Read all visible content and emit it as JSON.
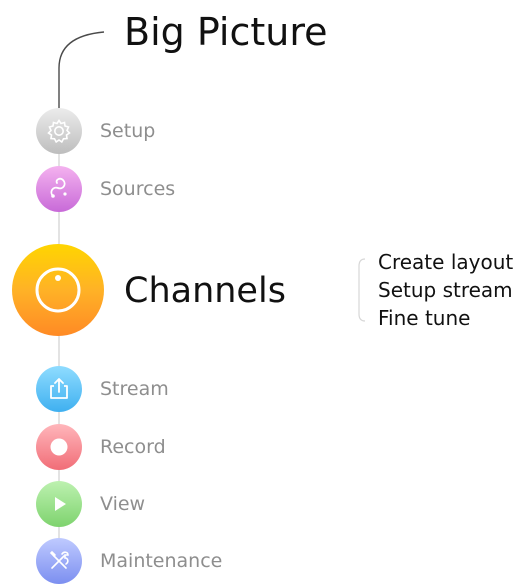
{
  "title": "Big Picture",
  "steps": [
    {
      "label": "Setup",
      "icon": "gear-icon",
      "color_top": "#e6e6e6",
      "color_bottom": "#bdbdbd"
    },
    {
      "label": "Sources",
      "icon": "swirl-icon",
      "color_top": "#f1a6ea",
      "color_bottom": "#c86ad8"
    },
    {
      "label": "Stream",
      "icon": "share-icon",
      "color_top": "#87d9ff",
      "color_bottom": "#3fb0f0"
    },
    {
      "label": "Record",
      "icon": "record-icon",
      "color_top": "#ffb1b6",
      "color_bottom": "#f16d77"
    },
    {
      "label": "View",
      "icon": "play-icon",
      "color_top": "#b9f0ab",
      "color_bottom": "#7ed36e"
    },
    {
      "label": "Maintenance",
      "icon": "tools-icon",
      "color_top": "#b9c6ff",
      "color_bottom": "#7c8ff0"
    }
  ],
  "active": {
    "label": "Channels",
    "icon": "circle-icon",
    "subtasks": [
      "Create layout",
      "Setup stream",
      "Fine tune"
    ]
  },
  "colors": {
    "connector": "#d7d7d7",
    "step_label": "#8e8e8e",
    "active_top": "#ffd500",
    "active_bottom": "#ff8a25"
  }
}
